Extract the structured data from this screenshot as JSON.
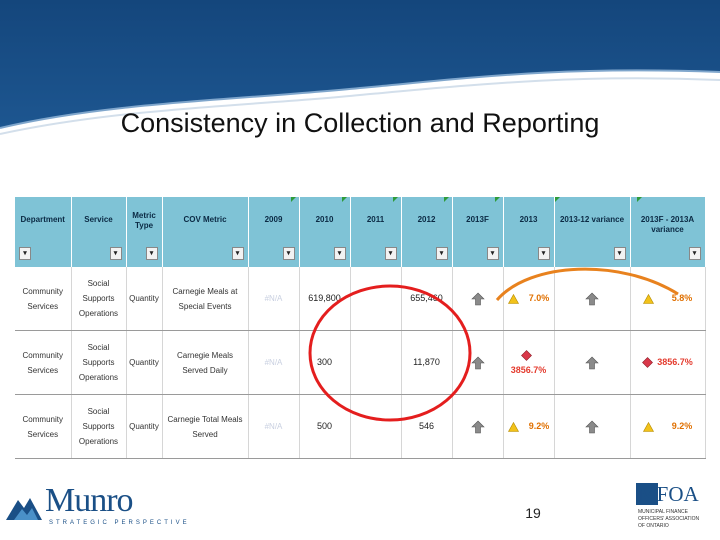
{
  "slide": {
    "title": "Consistency in Collection and Reporting",
    "page_number": "19"
  },
  "table": {
    "headers": [
      "Department",
      "Service",
      "Metric Type",
      "COV Metric",
      "2009",
      "2010",
      "2011",
      "2012",
      "2013F",
      "2013",
      "2013-12 variance",
      "2013F - 2013A variance"
    ],
    "rows": [
      {
        "department": "Community Services",
        "service": "Social Supports Operations",
        "metric_type": "Quantity",
        "cov_metric": "Carnegie Meals at Special Events",
        "y2009": "#N/A",
        "y2010": "619,800",
        "y2011": "",
        "y2012": "655,460",
        "y2013": "7.0%",
        "y2013_status": "warning",
        "variance_2013_12": "",
        "variance_2013f": "5.8%",
        "variance_2013f_status": "warning"
      },
      {
        "department": "Community Services",
        "service": "Social Supports Operations",
        "metric_type": "Quantity",
        "cov_metric": "Carnegie Meals Served Daily",
        "y2009": "#N/A",
        "y2010": "300",
        "y2011": "",
        "y2012": "11,870",
        "y2013": "3856.7%",
        "y2013_status": "alert",
        "variance_2013_12": "",
        "variance_2013f": "3856.7%",
        "variance_2013f_status": "alert"
      },
      {
        "department": "Community Services",
        "service": "Social Supports Operations",
        "metric_type": "Quantity",
        "cov_metric": "Carnegie Total Meals Served",
        "y2009": "#N/A",
        "y2010": "500",
        "y2011": "",
        "y2012": "546",
        "y2013": "9.2%",
        "y2013_status": "warning",
        "variance_2013_12": "",
        "variance_2013f": "9.2%",
        "variance_2013f_status": "warning"
      }
    ]
  },
  "logos": {
    "munro": {
      "name": "Munro",
      "tagline": "STRATEGIC PERSPECTIVE"
    },
    "mfoa": {
      "name": "MFOA",
      "line1": "MUNICIPAL FINANCE",
      "line2": "OFFICERS' ASSOCIATION",
      "line3": "OF ONTARIO"
    }
  },
  "colors": {
    "header_blue": "#1a4f86",
    "table_header": "#7fc3d6",
    "highlight_red": "#e41e1e",
    "highlight_orange": "#e8821e",
    "warning_yellow": "#f2c21a",
    "alert_red": "#d9384a",
    "pct_orange": "#e07000"
  }
}
